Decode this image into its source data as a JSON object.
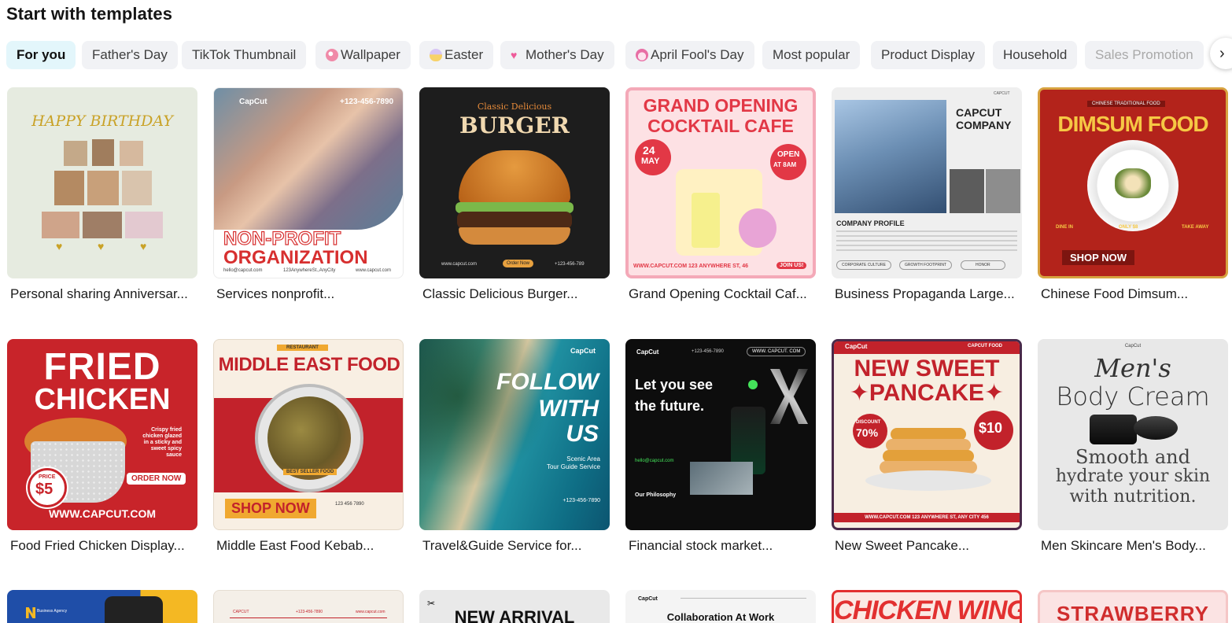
{
  "page": {
    "title": "Start with templates"
  },
  "categories": [
    {
      "label": "For you",
      "icon": "",
      "active": true
    },
    {
      "label": "Father's Day",
      "icon": ""
    },
    {
      "label": "TikTok Thumbnail",
      "icon": ""
    },
    {
      "label": "Wallpaper",
      "icon": "palette-icon",
      "icon_color": "#f08aa8"
    },
    {
      "label": "Easter",
      "icon": "easter-egg-icon",
      "icon_color": "#b9a8e8"
    },
    {
      "label": "Mother's Day",
      "icon": "heart-icon",
      "icon_color": "#ee5b9a"
    },
    {
      "label": "April Fool's Day",
      "icon": "clown-icon",
      "icon_color": "#e86fa5"
    },
    {
      "label": "Most popular",
      "icon": ""
    },
    {
      "label": "Product Display",
      "icon": ""
    },
    {
      "label": "Household",
      "icon": ""
    },
    {
      "label": "Sales Promotion",
      "icon": "",
      "faded": true
    }
  ],
  "next_arrow": "›",
  "templates": [
    {
      "label": "Personal sharing Anniversar...",
      "texts": {
        "headline": "HAPPY BIRTHDAY"
      }
    },
    {
      "label": "Services nonprofit...",
      "texts": {
        "brand": "CapCut",
        "phone": "+123-456-7890",
        "line1": "NON-PROFIT",
        "line2": "ORGANIZATION",
        "email": "hello@capcut.com",
        "address": "123AnywhereSt.,AnyCity",
        "site": "www.capcut.com"
      }
    },
    {
      "label": "Classic Delicious Burger...",
      "texts": {
        "sub": "Classic Delicious",
        "headline": "BURGER",
        "site": "www.capcut.com",
        "button": "Order Now",
        "phone": "+123-456-789"
      }
    },
    {
      "label": "Grand Opening Cocktail Caf...",
      "texts": {
        "line1": "GRAND OPENING",
        "line2": "COCKTAIL CAFE",
        "date1": "24",
        "date2": "MAY",
        "open1": "OPEN",
        "open2": "AT 8AM",
        "footer": "WWW.CAPCUT.COM  123 ANYWHERE ST, 46",
        "join": "JOIN US!"
      }
    },
    {
      "label": "Business Propaganda Large...",
      "texts": {
        "corner": "CAPCUT",
        "company1": "CAPCUT",
        "company2": "COMPANY",
        "profile": "COMPANY PROFILE",
        "tag1": "CORPORATE CULTURE",
        "tag2": "GROWTH FOOTPRINT",
        "tag3": "HONOR"
      }
    },
    {
      "label": "Chinese Food Dimsum...",
      "texts": {
        "banner": "CHINESE TRADITIONAL FOOD",
        "headline": "DIMSUM FOOD",
        "dine": "DINE IN",
        "price": "ONLY $8",
        "takeaway": "TAKE AWAY",
        "button": "SHOP NOW"
      }
    },
    {
      "label": "Food Fried Chicken Display...",
      "texts": {
        "line1": "FRIED",
        "line2": "CHICKEN",
        "desc": "Crispy fried chicken glazed in a sticky and sweet spicy sauce",
        "price_label": "PRICE",
        "price": "$5",
        "button": "ORDER NOW",
        "site": "WWW.CAPCUT.COM"
      }
    },
    {
      "label": "Middle East Food Kebab...",
      "texts": {
        "banner": "RESTAURANT",
        "headline": "MIDDLE EAST FOOD",
        "badge": "BEST SELLER FOOD",
        "button": "SHOP NOW",
        "info": "123 456 7890"
      }
    },
    {
      "label": "Travel&Guide Service for...",
      "texts": {
        "brand": "CapCut",
        "line1": "FOLLOW",
        "line2": "WITH",
        "line3": "US",
        "sub1": "Scenic Area",
        "sub2": "Tour Guide Service",
        "phone": "+123-456-7890"
      }
    },
    {
      "label": "Financial stock market...",
      "texts": {
        "brand": "CapCut",
        "phone": "+123-456-7890",
        "site": "WWW. CAPCUT. COM",
        "line1": "Let you see",
        "line2": "the future.",
        "email": "hello@capcut.com",
        "philosophy": "Our Philosophy"
      }
    },
    {
      "label": "New Sweet Pancake...",
      "texts": {
        "brand": "CapCut",
        "tag": "CAPCUT FOOD",
        "line1": "NEW SWEET",
        "line2": "✦PANCAKE✦",
        "discount": "DISCOUNT",
        "pct": "70%",
        "price": "$10",
        "footer": "WWW.CAPCUT.COM  123 ANYWHERE ST, ANY CITY 456"
      }
    },
    {
      "label": "Men Skincare Men's Body...",
      "texts": {
        "brand": "CapCut",
        "line1": "Men's",
        "line2": "Body Cream",
        "line3": "Smooth and",
        "line4": "hydrate your skin",
        "line5": "with nutrition."
      }
    },
    {
      "label": "",
      "texts": {
        "brand": "Business Agency"
      }
    },
    {
      "label": "",
      "texts": {
        "brand": "CAPCUT",
        "phone": "+123-456-7890",
        "site": "www.capcut.com"
      }
    },
    {
      "label": "",
      "texts": {
        "headline": "NEW ARRIVAL"
      }
    },
    {
      "label": "",
      "texts": {
        "brand": "CapCut",
        "headline": "Collaboration At Work"
      }
    },
    {
      "label": "",
      "texts": {
        "headline": "CHICKEN WINGS"
      }
    },
    {
      "label": "",
      "texts": {
        "headline": "STRAWBERRY"
      }
    }
  ]
}
